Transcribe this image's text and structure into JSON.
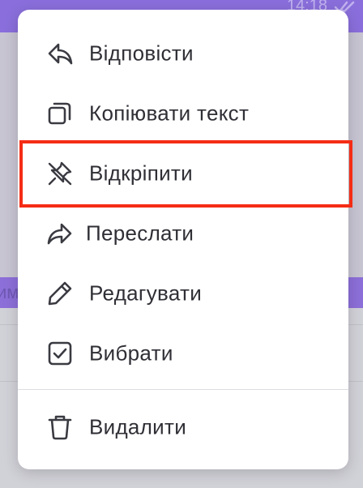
{
  "status": {
    "time": "14:18"
  },
  "background": {
    "partial_text": "им"
  },
  "menu": {
    "items": [
      {
        "key": "reply",
        "label": "Відповісти",
        "icon": "reply-icon"
      },
      {
        "key": "copy",
        "label": "Копіювати текст",
        "icon": "copy-icon"
      },
      {
        "key": "unpin",
        "label": "Відкріпити",
        "icon": "unpin-icon"
      },
      {
        "key": "forward",
        "label": "Переслати",
        "icon": "forward-icon"
      },
      {
        "key": "edit",
        "label": "Редагувати",
        "icon": "pencil-icon"
      },
      {
        "key": "select",
        "label": "Вибрати",
        "icon": "checkbox-icon"
      },
      {
        "key": "delete",
        "label": "Видалити",
        "icon": "trash-icon"
      }
    ],
    "highlighted_item": "unpin"
  },
  "colors": {
    "text": "#2f2f36",
    "icon": "#3a3a42",
    "highlight_border": "#f52c15",
    "accent_purple": "#8a6fdc"
  }
}
